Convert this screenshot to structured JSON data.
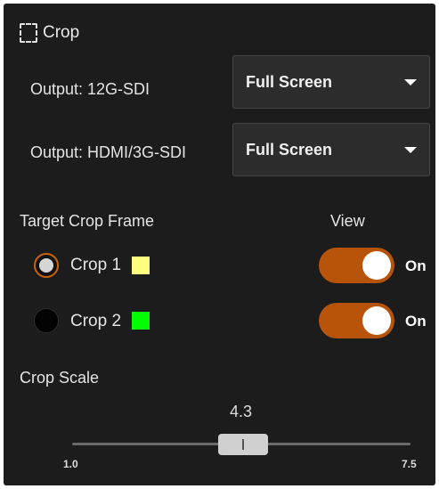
{
  "title": "Crop",
  "outputs": [
    {
      "label": "Output: 12G-SDI",
      "value": "Full Screen"
    },
    {
      "label": "Output: HDMI/3G-SDI",
      "value": "Full Screen"
    }
  ],
  "target_label": "Target Crop Frame",
  "view_label": "View",
  "crops": [
    {
      "label": "Crop 1",
      "selected": true,
      "color": "#ffff80",
      "view": "On"
    },
    {
      "label": "Crop 2",
      "selected": false,
      "color": "#00ff00",
      "view": "On"
    }
  ],
  "scale": {
    "label": "Crop Scale",
    "value": "4.3",
    "min": "1.0",
    "max": "7.5"
  },
  "accent_color": "#b8540a"
}
